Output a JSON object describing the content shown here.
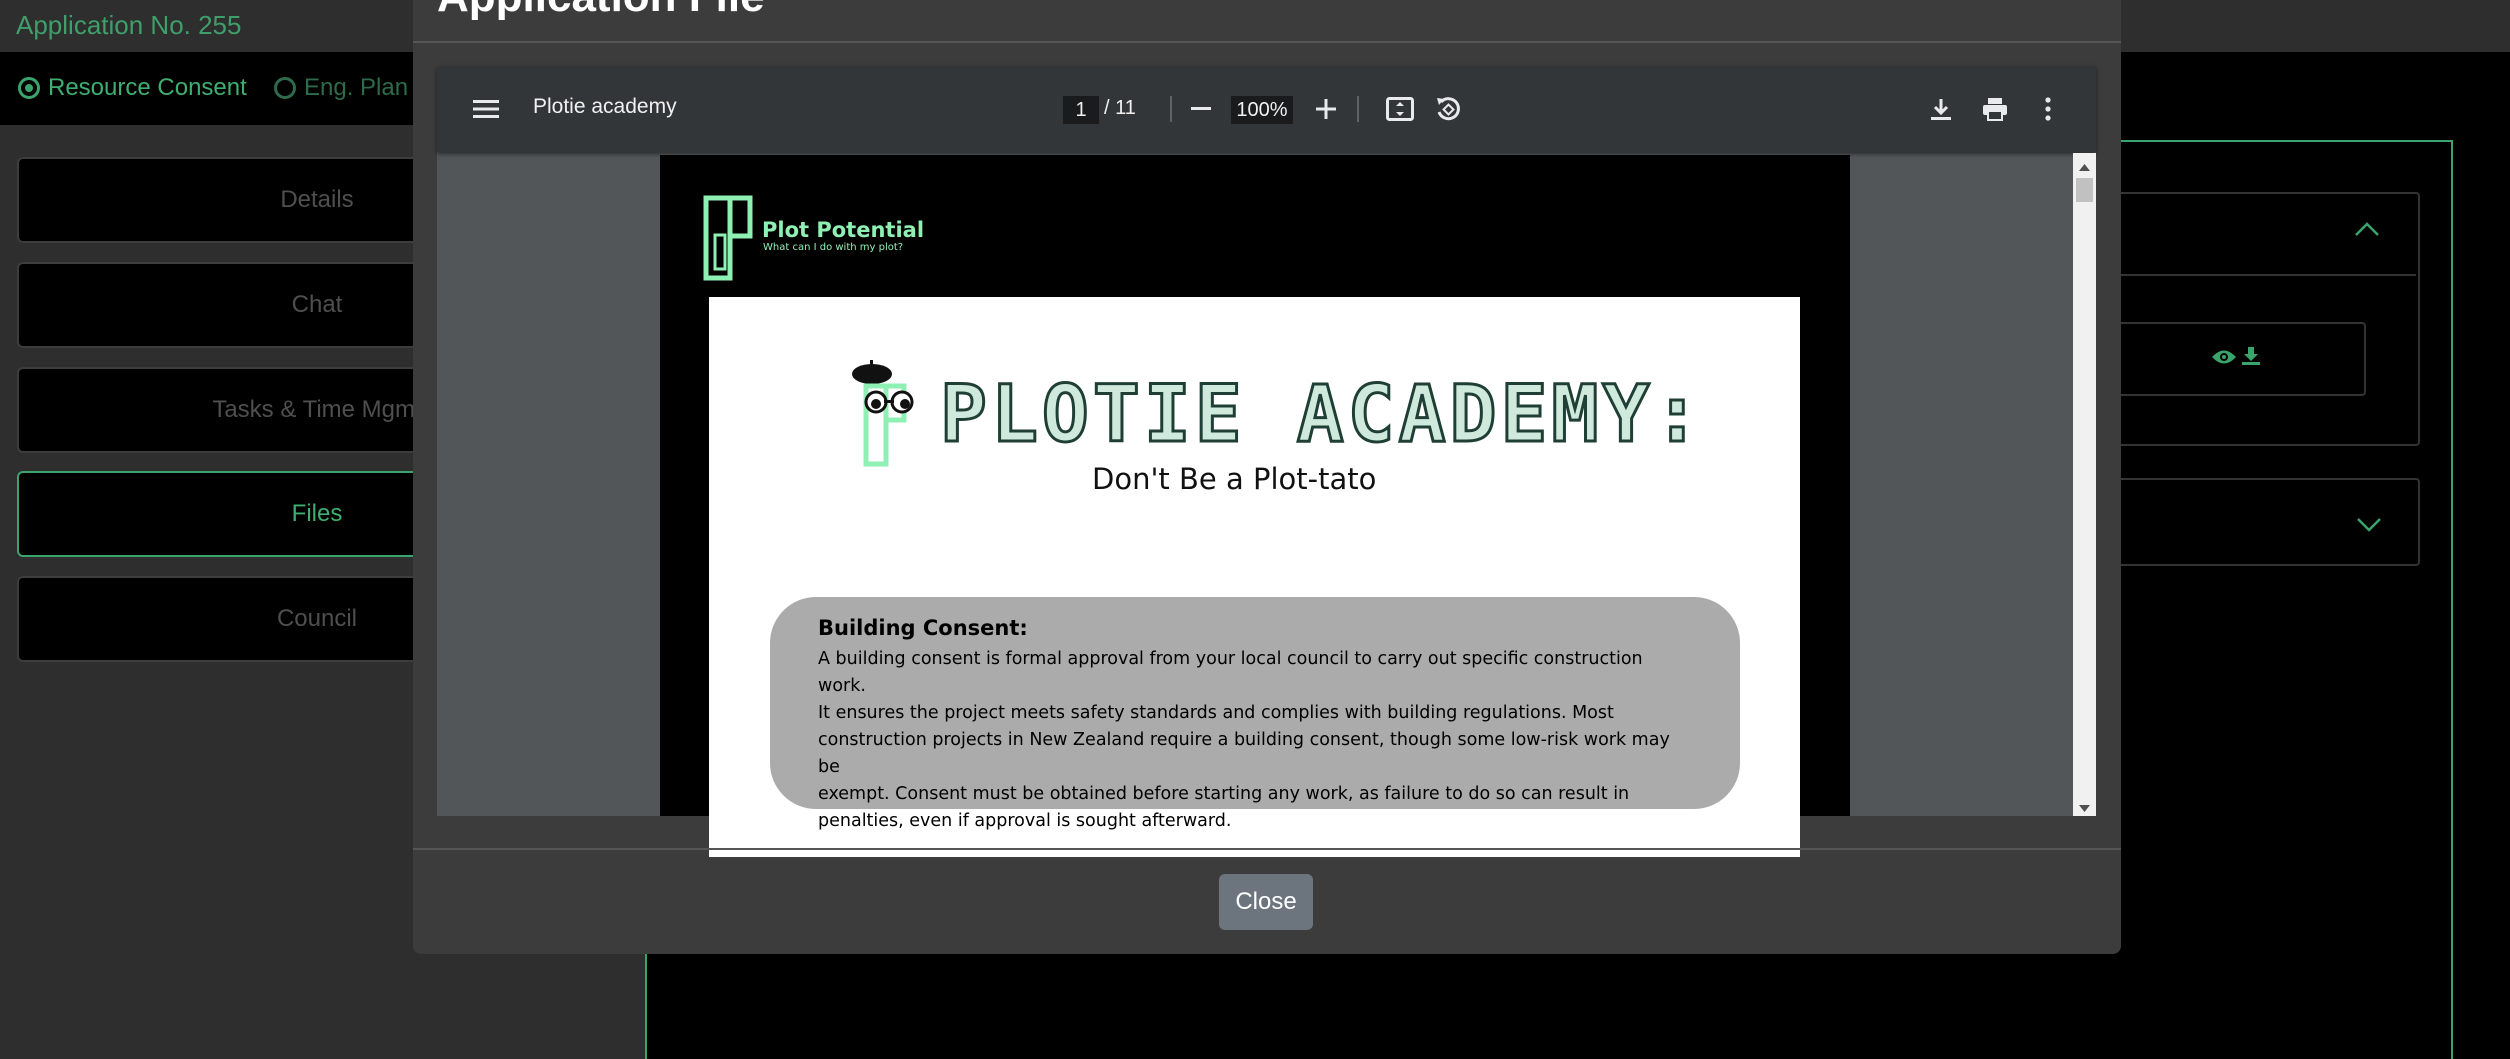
{
  "app": {
    "title": "Application No. 255"
  },
  "consent_types": [
    {
      "label": "Resource Consent",
      "selected": true
    },
    {
      "label": "Eng. Plan",
      "selected": false
    }
  ],
  "nav": [
    "Details",
    "Chat",
    "Tasks & Time Mgmt",
    "Files",
    "Council"
  ],
  "nav_active": "Files",
  "modal": {
    "title": "Application File",
    "close_label": "Close"
  },
  "pdf_viewer": {
    "doc_title": "Plotie academy",
    "page_current": "1",
    "page_total": "/ 11",
    "zoom": "100%",
    "icons": [
      "menu-icon",
      "zoom-out-icon",
      "zoom-in-icon",
      "fit-page-icon",
      "rotate-icon",
      "download-icon",
      "print-icon",
      "more-icon"
    ]
  },
  "document": {
    "brand_name": "Plot Potential",
    "brand_tagline": "What can I do with my plot?",
    "heading": "PLOTIE ACADEMY:",
    "subheading": "Don't Be a Plot-tato",
    "section_title": "Building Consent:",
    "section_lines": [
      "A building consent is formal approval from your local council to carry out specific construction work.",
      "It ensures the project meets safety standards and complies with building regulations. Most",
      "construction projects in New Zealand require a building consent, though some low-risk work may be",
      "exempt. Consent must be obtained before starting any work, as failure to do so can result in",
      "penalties, even if approval is sought afterward."
    ]
  },
  "colors": {
    "accent": "#3aa46c",
    "brand_mint": "#8ff0b4",
    "modal_bg": "#3c3c3c",
    "viewer_bg": "#525659",
    "toolbar_bg": "#323639"
  }
}
